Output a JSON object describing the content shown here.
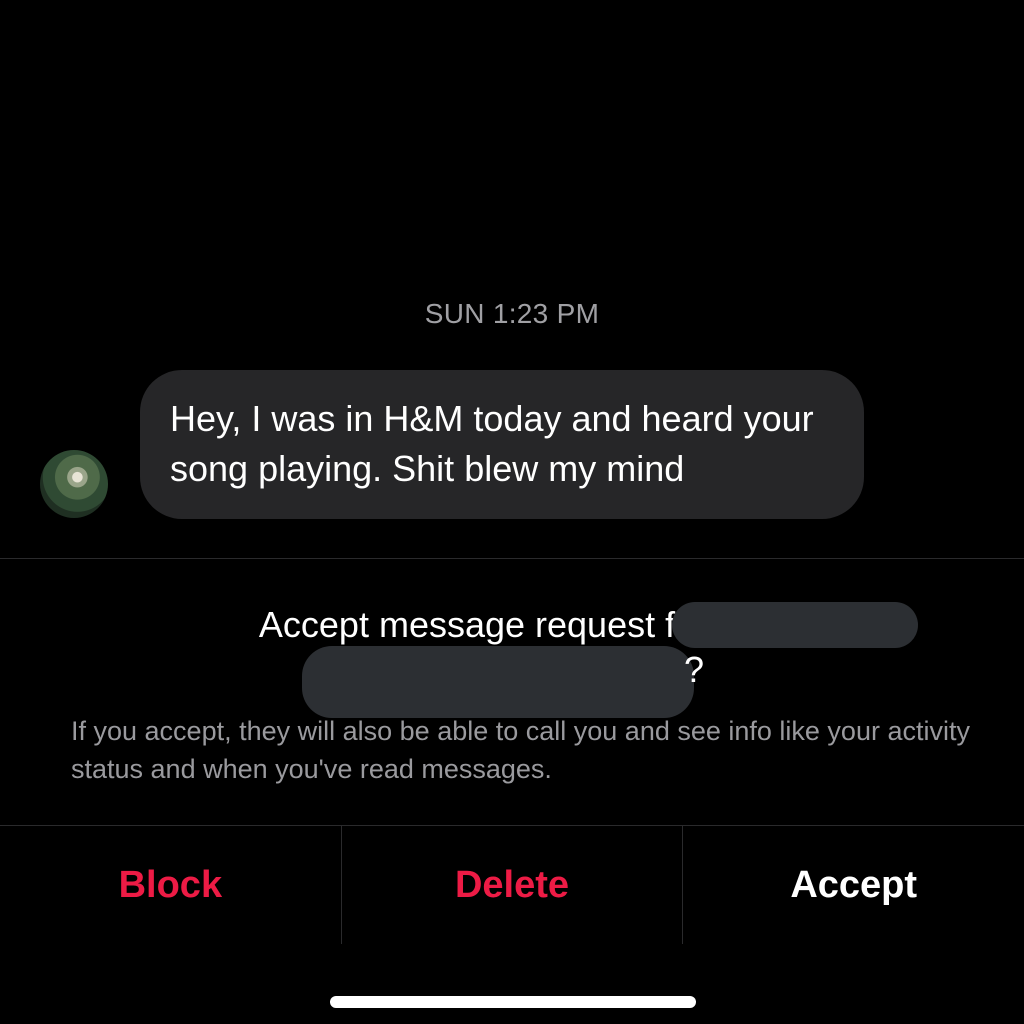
{
  "thread": {
    "timestamp": "SUN 1:23 PM",
    "message": "Hey, I was in H&M today and heard your song playing. Shit blew my mind"
  },
  "request": {
    "title_prefix": "Accept message request from J",
    "title_suffix": "?",
    "info": "If you accept, they will also be able to call you and see info like your activity status and when you've read messages."
  },
  "actions": {
    "block": "Block",
    "delete": "Delete",
    "accept": "Accept"
  },
  "colors": {
    "destructive": "#ED1B45",
    "accept": "#FFFFFF",
    "bubble": "#262628",
    "background": "#000000"
  }
}
